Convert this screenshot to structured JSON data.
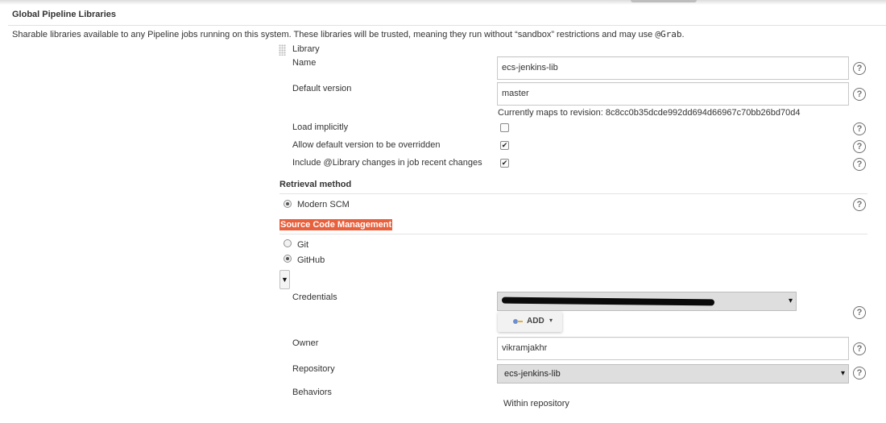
{
  "section": {
    "title": "Global Pipeline Libraries",
    "description": "Sharable libraries available to any Pipeline jobs running on this system. These libraries will be trusted, meaning they run without “sandbox” restrictions and may use ",
    "description_code": "@Grab",
    "description_end": "."
  },
  "library": {
    "header": "Library",
    "name_label": "Name",
    "name_value": "ecs-jenkins-lib",
    "default_version_label": "Default version",
    "default_version_value": "master",
    "revision_note": "Currently maps to revision: 8c8cc0b35dcde992dd694d66967c70bb26bd70d4",
    "load_implicitly_label": "Load implicitly",
    "load_implicitly_checked": false,
    "allow_override_label": "Allow default version to be overridden",
    "allow_override_checked": true,
    "include_changes_label": "Include @Library changes in job recent changes",
    "include_changes_checked": true
  },
  "retrieval": {
    "title": "Retrieval method",
    "option_modern_scm": "Modern SCM"
  },
  "scm": {
    "title": "Source Code Management",
    "option_git": "Git",
    "option_github": "GitHub",
    "selected": "GitHub",
    "credentials_label": "Credentials",
    "add_button_label": "ADD",
    "owner_label": "Owner",
    "owner_value": "vikramjakhr",
    "repository_label": "Repository",
    "repository_value": "ecs-jenkins-lib",
    "behaviors_label": "Behaviors",
    "behaviors_item": "Within repository"
  },
  "icons": {
    "help": "?",
    "check": "✔",
    "dropdown": "▾",
    "toggle": "▼",
    "caret": "▾"
  },
  "colors": {
    "scm_title_background": "#e8603c",
    "select_background": "#dedede"
  }
}
